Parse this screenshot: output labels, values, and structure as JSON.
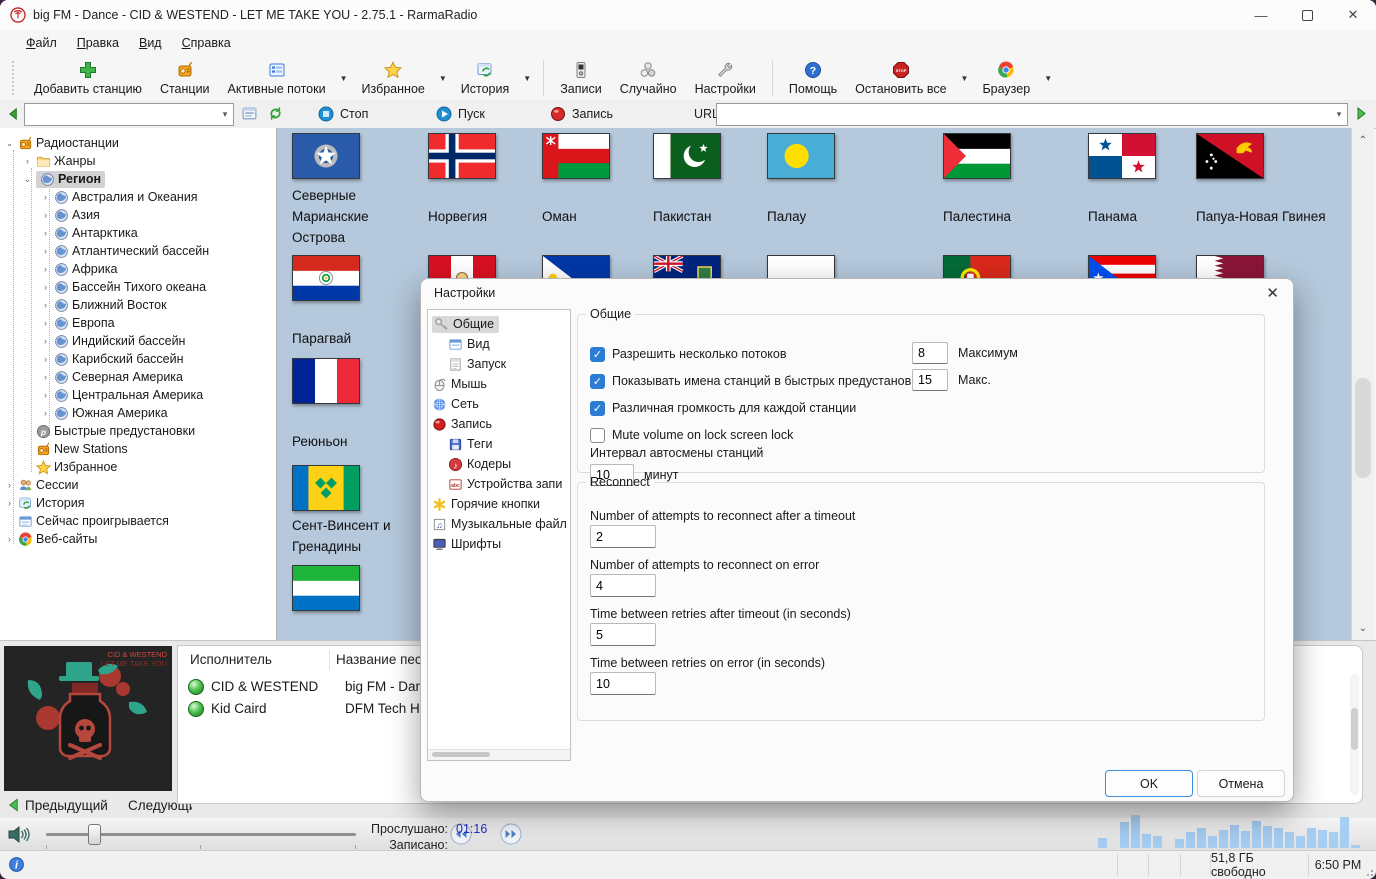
{
  "window": {
    "title": "big FM - Dance - CID & WESTEND - LET ME TAKE YOU - 2.75.1 - RarmaRadio"
  },
  "menu": {
    "items": [
      "Файл",
      "Правка",
      "Вид",
      "Справка"
    ]
  },
  "toolbar": {
    "items": [
      {
        "id": "add-station",
        "label": "Добавить станцию",
        "icon": "add-station"
      },
      {
        "id": "stations",
        "label": "Станции",
        "icon": "stations"
      },
      {
        "id": "active-streams",
        "label": "Активные потоки",
        "icon": "streams",
        "dropdown": true
      },
      {
        "id": "favorites",
        "label": "Избранное",
        "icon": "favorites",
        "dropdown": true
      },
      {
        "id": "history",
        "label": "История",
        "icon": "history",
        "dropdown": true
      },
      {
        "sep": true
      },
      {
        "id": "recordings",
        "label": "Записи",
        "icon": "recordings"
      },
      {
        "id": "random",
        "label": "Случайно",
        "icon": "random"
      },
      {
        "id": "settings",
        "label": "Настройки",
        "icon": "settings"
      },
      {
        "sep": true
      },
      {
        "id": "help",
        "label": "Помощь",
        "icon": "help"
      },
      {
        "id": "stop-all",
        "label": "Остановить все",
        "icon": "stop-all",
        "dropdown": true
      },
      {
        "id": "browser",
        "label": "Браузер",
        "icon": "browser",
        "dropdown": true
      }
    ]
  },
  "transport": {
    "stop": "Стоп",
    "play": "Пуск",
    "record": "Запись",
    "url_label": "URL",
    "stop_icon": "stop-round",
    "play_icon": "play-round",
    "record_icon": "rec-round"
  },
  "sidebar": {
    "items": [
      {
        "id": "radiostations",
        "label": "Радиостанции",
        "level": 0,
        "icon": "radio",
        "arrow": "down"
      },
      {
        "id": "genres",
        "label": "Жанры",
        "level": 1,
        "icon": "folder",
        "arrow": "right"
      },
      {
        "id": "region",
        "label": "Регион",
        "level": 1,
        "icon": "globe",
        "arrow": "down",
        "selected": true
      },
      {
        "id": "australia-oceania",
        "label": "Австралия и Океания",
        "level": 2,
        "icon": "globe",
        "arrow": "right"
      },
      {
        "id": "asia",
        "label": "Азия",
        "level": 2,
        "icon": "globe",
        "arrow": "right"
      },
      {
        "id": "antarctica",
        "label": "Антарктика",
        "level": 2,
        "icon": "globe",
        "arrow": "right"
      },
      {
        "id": "atlantic",
        "label": "Атлантический бассейн",
        "level": 2,
        "icon": "globe",
        "arrow": "right"
      },
      {
        "id": "africa",
        "label": "Африка",
        "level": 2,
        "icon": "globe",
        "arrow": "right"
      },
      {
        "id": "pacific",
        "label": "Бассейн Тихого океана",
        "level": 2,
        "icon": "globe",
        "arrow": "right"
      },
      {
        "id": "middle-east",
        "label": "Ближний Восток",
        "level": 2,
        "icon": "globe",
        "arrow": "right"
      },
      {
        "id": "europe",
        "label": "Европа",
        "level": 2,
        "icon": "globe",
        "arrow": "right"
      },
      {
        "id": "indian",
        "label": "Индийский бассейн",
        "level": 2,
        "icon": "globe",
        "arrow": "right"
      },
      {
        "id": "caribbean",
        "label": "Карибский бассейн",
        "level": 2,
        "icon": "globe",
        "arrow": "right"
      },
      {
        "id": "north-america",
        "label": "Северная Америка",
        "level": 2,
        "icon": "globe",
        "arrow": "right"
      },
      {
        "id": "central-america",
        "label": "Центральная Америка",
        "level": 2,
        "icon": "globe",
        "arrow": "right"
      },
      {
        "id": "south-america",
        "label": "Южная Америка",
        "level": 2,
        "icon": "globe",
        "arrow": "right"
      },
      {
        "id": "quick-presets",
        "label": "Быстрые предустановки",
        "level": 1,
        "icon": "preset"
      },
      {
        "id": "new-stations",
        "label": "New Stations",
        "level": 1,
        "icon": "radio"
      },
      {
        "id": "favorites",
        "label": "Избранное",
        "level": 1,
        "icon": "star"
      },
      {
        "id": "sessions",
        "label": "Сессии",
        "level": 0,
        "icon": "users",
        "arrow": "right"
      },
      {
        "id": "history",
        "label": "История",
        "level": 0,
        "icon": "history",
        "arrow": "right"
      },
      {
        "id": "now-playing",
        "label": "Сейчас проигрывается",
        "level": 0,
        "icon": "nowplaying"
      },
      {
        "id": "websites",
        "label": "Веб-сайты",
        "level": 0,
        "icon": "browser",
        "arrow": "right"
      }
    ]
  },
  "stations": {
    "row1": [
      {
        "name": "Северные Марианские Острова",
        "flag": "mp"
      },
      {
        "name": "Норвегия",
        "flag": "no"
      },
      {
        "name": "Оман",
        "flag": "om"
      },
      {
        "name": "Пакистан",
        "flag": "pk"
      },
      {
        "name": "Палау",
        "flag": "pw"
      },
      {
        "name": "Палестина",
        "flag": "ps"
      },
      {
        "name": "Панама",
        "flag": "pa"
      },
      {
        "name": "Папуа-Новая Гвинея",
        "flag": "pg"
      }
    ],
    "row2_partial_flags": [
      "pe",
      "ph",
      "pn",
      "pl",
      "pt",
      "pr",
      "qa"
    ],
    "column1": [
      {
        "name": "Парагвай",
        "flag": "py"
      },
      {
        "name": "Реюньон",
        "flag": "re"
      },
      {
        "name": "Сент-Винсент и Гренадины",
        "flag": "vc"
      },
      {
        "name": "",
        "flag": "sl"
      }
    ]
  },
  "dialog": {
    "title": "Настройки",
    "tree": [
      {
        "id": "general",
        "label": "Общие",
        "level": 0,
        "icon": "key",
        "selected": true
      },
      {
        "id": "view",
        "label": "Вид",
        "level": 1,
        "icon": "view"
      },
      {
        "id": "startup",
        "label": "Запуск",
        "level": 1,
        "icon": "launch"
      },
      {
        "id": "mouse",
        "label": "Мышь",
        "level": 0,
        "icon": "mouse"
      },
      {
        "id": "network",
        "label": "Сеть",
        "level": 0,
        "icon": "net"
      },
      {
        "id": "recording",
        "label": "Запись",
        "level": 0,
        "icon": "recball"
      },
      {
        "id": "tags",
        "label": "Теги",
        "level": 1,
        "icon": "tags"
      },
      {
        "id": "coders",
        "label": "Кодеры",
        "level": 1,
        "icon": "coders"
      },
      {
        "id": "record-devices",
        "label": "Устройства запи",
        "level": 1,
        "icon": "devices"
      },
      {
        "id": "hotkeys",
        "label": "Горячие кнопки",
        "level": 0,
        "icon": "hotkeys"
      },
      {
        "id": "music-files",
        "label": "Музыкальные файл",
        "level": 0,
        "icon": "musfiles"
      },
      {
        "id": "fonts",
        "label": "Шрифты",
        "level": 0,
        "icon": "fonts"
      }
    ],
    "general": {
      "title": "Общие",
      "checkboxes": [
        {
          "label": "Разрешить несколько потоков",
          "checked": true,
          "field": "8",
          "suffix": "Максимум"
        },
        {
          "label": "Показывать имена станций в быстрых предустановках",
          "checked": true,
          "field": "15",
          "suffix": "Макс."
        },
        {
          "label": "Различная громкость для каждой станции",
          "checked": true
        },
        {
          "label": "Mute volume on lock screen lock",
          "checked": false
        }
      ],
      "interval_label": "Интервал автосмены станций",
      "interval_value": "10",
      "interval_suffix": "минут"
    },
    "reconnect": {
      "title": "Reconnect",
      "fields": [
        {
          "label": "Number of attempts to reconnect after a timeout",
          "value": "2"
        },
        {
          "label": "Number of attempts to reconnect on error",
          "value": "4"
        },
        {
          "label": "Time between retries after timeout (in seconds)",
          "value": "5"
        },
        {
          "label": "Time between retries on error (in seconds)",
          "value": "10"
        }
      ]
    },
    "ok": "OK",
    "cancel": "Отмена"
  },
  "now_playing": {
    "columns": [
      "Исполнитель",
      "Название песни"
    ],
    "rows": [
      {
        "artist": "CID & WESTEND",
        "song": "big FM - Dance"
      },
      {
        "artist": "Kid Caird",
        "song": "DFM Tech House"
      }
    ],
    "prev": "Предыдущий",
    "next": "Следующий",
    "art_line1": "CID & WESTEND",
    "art_line2": "LET ME TAKE YOU"
  },
  "playback": {
    "listened_label": "Прослушано:",
    "listened_value": "01:16",
    "recorded_label": "Записано:"
  },
  "status": {
    "free_space": "51,8 ГБ свободно",
    "clock": "6:50 PM"
  },
  "spectrum": {
    "bars": [
      10,
      0,
      26,
      33,
      14,
      12,
      0,
      9,
      16,
      20,
      12,
      18,
      23,
      17,
      27,
      22,
      20,
      16,
      12,
      20,
      18,
      16,
      31,
      3
    ],
    "color": "#a6cdf2"
  }
}
